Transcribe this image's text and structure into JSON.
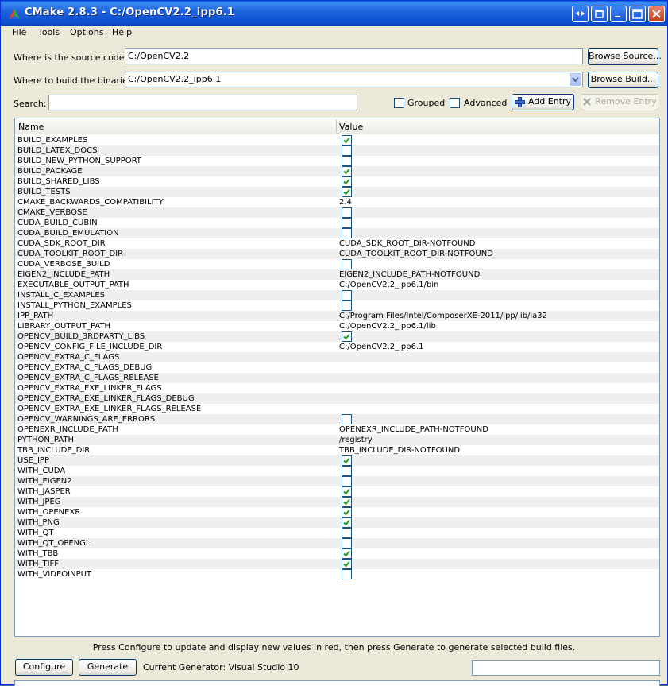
{
  "window": {
    "title": "CMake 2.8.3 - C:/OpenCV2.2_ipp6.1",
    "colors": {
      "titlebar": "#1e63dc",
      "close": "#c2401d",
      "face": "#ece9d8"
    }
  },
  "menu": [
    "File",
    "Tools",
    "Options",
    "Help"
  ],
  "source": {
    "label": "Where is the source code:",
    "value": "C:/OpenCV2.2",
    "browse_label": "Browse Source..."
  },
  "build": {
    "label": "Where to build the binaries:",
    "value": "C:/OpenCV2.2_ipp6.1",
    "browse_label": "Browse Build..."
  },
  "search": {
    "label": "Search:",
    "value": "",
    "grouped_label": "Grouped",
    "advanced_label": "Advanced",
    "add_label": "Add Entry",
    "remove_label": "Remove Entry"
  },
  "table": {
    "columns": [
      "Name",
      "Value"
    ],
    "rows": [
      {
        "name": "BUILD_EXAMPLES",
        "type": "bool",
        "value": true
      },
      {
        "name": "BUILD_LATEX_DOCS",
        "type": "bool",
        "value": false
      },
      {
        "name": "BUILD_NEW_PYTHON_SUPPORT",
        "type": "bool",
        "value": false
      },
      {
        "name": "BUILD_PACKAGE",
        "type": "bool",
        "value": true
      },
      {
        "name": "BUILD_SHARED_LIBS",
        "type": "bool",
        "value": true
      },
      {
        "name": "BUILD_TESTS",
        "type": "bool",
        "value": true
      },
      {
        "name": "CMAKE_BACKWARDS_COMPATIBILITY",
        "type": "text",
        "value": "2.4"
      },
      {
        "name": "CMAKE_VERBOSE",
        "type": "bool",
        "value": false
      },
      {
        "name": "CUDA_BUILD_CUBIN",
        "type": "bool",
        "value": false
      },
      {
        "name": "CUDA_BUILD_EMULATION",
        "type": "bool",
        "value": false
      },
      {
        "name": "CUDA_SDK_ROOT_DIR",
        "type": "text",
        "value": "CUDA_SDK_ROOT_DIR-NOTFOUND"
      },
      {
        "name": "CUDA_TOOLKIT_ROOT_DIR",
        "type": "text",
        "value": "CUDA_TOOLKIT_ROOT_DIR-NOTFOUND"
      },
      {
        "name": "CUDA_VERBOSE_BUILD",
        "type": "bool",
        "value": false
      },
      {
        "name": "EIGEN2_INCLUDE_PATH",
        "type": "text",
        "value": "EIGEN2_INCLUDE_PATH-NOTFOUND"
      },
      {
        "name": "EXECUTABLE_OUTPUT_PATH",
        "type": "text",
        "value": "C:/OpenCV2.2_ipp6.1/bin"
      },
      {
        "name": "INSTALL_C_EXAMPLES",
        "type": "bool",
        "value": false
      },
      {
        "name": "INSTALL_PYTHON_EXAMPLES",
        "type": "bool",
        "value": false
      },
      {
        "name": "IPP_PATH",
        "type": "text",
        "value": "C:/Program Files/Intel/ComposerXE-2011/ipp/lib/ia32"
      },
      {
        "name": "LIBRARY_OUTPUT_PATH",
        "type": "text",
        "value": "C:/OpenCV2.2_ipp6.1/lib"
      },
      {
        "name": "OPENCV_BUILD_3RDPARTY_LIBS",
        "type": "bool",
        "value": true
      },
      {
        "name": "OPENCV_CONFIG_FILE_INCLUDE_DIR",
        "type": "text",
        "value": "C:/OpenCV2.2_ipp6.1"
      },
      {
        "name": "OPENCV_EXTRA_C_FLAGS",
        "type": "text",
        "value": ""
      },
      {
        "name": "OPENCV_EXTRA_C_FLAGS_DEBUG",
        "type": "text",
        "value": ""
      },
      {
        "name": "OPENCV_EXTRA_C_FLAGS_RELEASE",
        "type": "text",
        "value": ""
      },
      {
        "name": "OPENCV_EXTRA_EXE_LINKER_FLAGS",
        "type": "text",
        "value": ""
      },
      {
        "name": "OPENCV_EXTRA_EXE_LINKER_FLAGS_DEBUG",
        "type": "text",
        "value": ""
      },
      {
        "name": "OPENCV_EXTRA_EXE_LINKER_FLAGS_RELEASE",
        "type": "text",
        "value": ""
      },
      {
        "name": "OPENCV_WARNINGS_ARE_ERRORS",
        "type": "bool",
        "value": false
      },
      {
        "name": "OPENEXR_INCLUDE_PATH",
        "type": "text",
        "value": "OPENEXR_INCLUDE_PATH-NOTFOUND"
      },
      {
        "name": "PYTHON_PATH",
        "type": "text",
        "value": "/registry"
      },
      {
        "name": "TBB_INCLUDE_DIR",
        "type": "text",
        "value": "TBB_INCLUDE_DIR-NOTFOUND"
      },
      {
        "name": "USE_IPP",
        "type": "bool",
        "value": true
      },
      {
        "name": "WITH_CUDA",
        "type": "bool",
        "value": false
      },
      {
        "name": "WITH_EIGEN2",
        "type": "bool",
        "value": false
      },
      {
        "name": "WITH_JASPER",
        "type": "bool",
        "value": true
      },
      {
        "name": "WITH_JPEG",
        "type": "bool",
        "value": true
      },
      {
        "name": "WITH_OPENEXR",
        "type": "bool",
        "value": true
      },
      {
        "name": "WITH_PNG",
        "type": "bool",
        "value": true
      },
      {
        "name": "WITH_QT",
        "type": "bool",
        "value": false
      },
      {
        "name": "WITH_QT_OPENGL",
        "type": "bool",
        "value": false
      },
      {
        "name": "WITH_TBB",
        "type": "bool",
        "value": true
      },
      {
        "name": "WITH_TIFF",
        "type": "bool",
        "value": true
      },
      {
        "name": "WITH_VIDEOINPUT",
        "type": "bool",
        "value": false
      }
    ]
  },
  "footer": {
    "hint": "Press Configure to update and display new values in red, then press Generate to generate selected build files.",
    "configure_label": "Configure",
    "generate_label": "Generate",
    "generator_label": "Current Generator: Visual Studio 10"
  },
  "icons": [
    "cmake-logo-icon",
    "resize-icon",
    "restore-layout-icon",
    "minimize-icon",
    "maximize-icon",
    "close-icon",
    "chevron-down-icon",
    "plus-icon",
    "x-icon",
    "checkmark-icon"
  ]
}
